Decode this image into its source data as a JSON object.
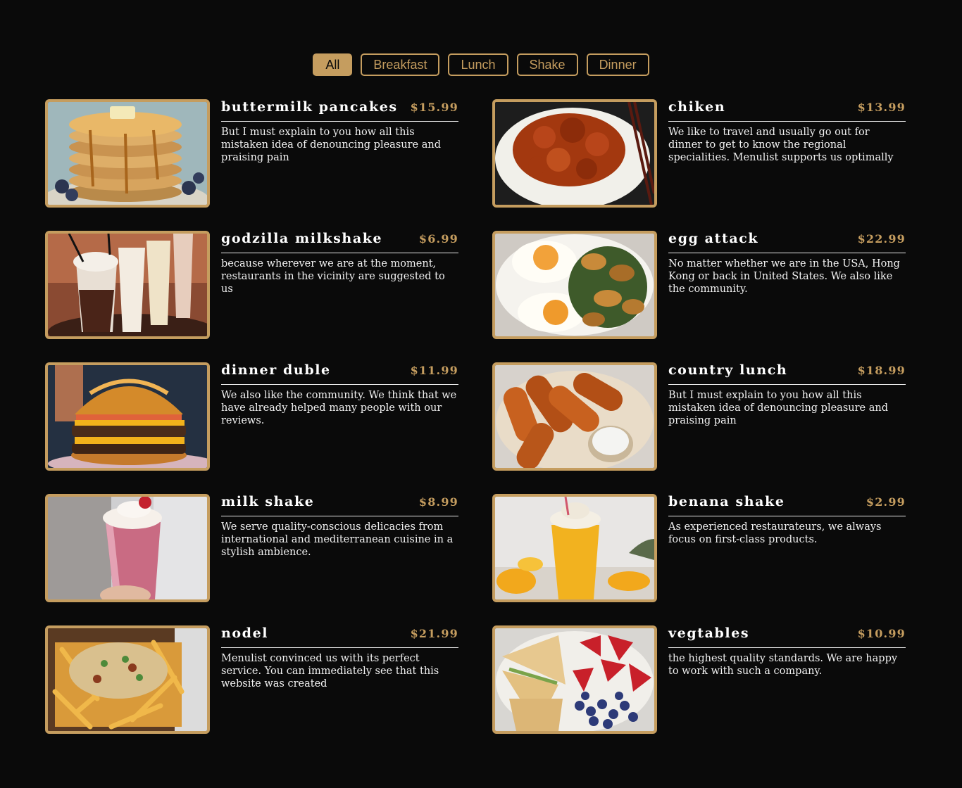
{
  "filters": [
    {
      "label": "All",
      "active": true
    },
    {
      "label": "Breakfast",
      "active": false
    },
    {
      "label": "Lunch",
      "active": false
    },
    {
      "label": "Shake",
      "active": false
    },
    {
      "label": "Dinner",
      "active": false
    }
  ],
  "menu": [
    {
      "title": "buttermilk pancakes",
      "price": "$15.99",
      "desc": "But I must explain to you how all this mistaken idea of denouncing pleasure and praising pain",
      "image": "pancakes"
    },
    {
      "title": "chiken",
      "price": "$13.99",
      "desc": "We like to travel and usually go out for dinner to get to know the regional specialities. Menulist supports us optimally",
      "image": "chicken"
    },
    {
      "title": "godzilla milkshake",
      "price": "$6.99",
      "desc": "because wherever we are at the moment, restaurants in the vicinity are suggested to us",
      "image": "milkshakes"
    },
    {
      "title": "egg attack",
      "price": "$22.99",
      "desc": "No matter whether we are in the USA, Hong Kong or back in United States. We also like the community.",
      "image": "eggs"
    },
    {
      "title": "dinner duble",
      "price": "$11.99",
      "desc": "We also like the community. We think that we have already helped many people with our reviews.",
      "image": "burger"
    },
    {
      "title": "country lunch",
      "price": "$18.99",
      "desc": "But I must explain to you how all this mistaken idea of denouncing pleasure and praising pain",
      "image": "tenders"
    },
    {
      "title": "milk shake",
      "price": "$8.99",
      "desc": "We serve quality-conscious delicacies from international and mediterranean cuisine in a stylish ambience.",
      "image": "pinkshake"
    },
    {
      "title": "benana shake",
      "price": "$2.99",
      "desc": "As experienced restaurateurs, we always focus on first-class products.",
      "image": "mangoshake"
    },
    {
      "title": "nodel",
      "price": "$21.99",
      "desc": "Menulist convinced us with its perfect service. You can immediately see that this website was created",
      "image": "fries"
    },
    {
      "title": "vegtables",
      "price": "$10.99",
      "desc": "the highest quality standards. We are happy to work with such a company.",
      "image": "quesadilla"
    }
  ],
  "colors": {
    "accent": "#c59d5f",
    "background": "#0a0a0a"
  }
}
